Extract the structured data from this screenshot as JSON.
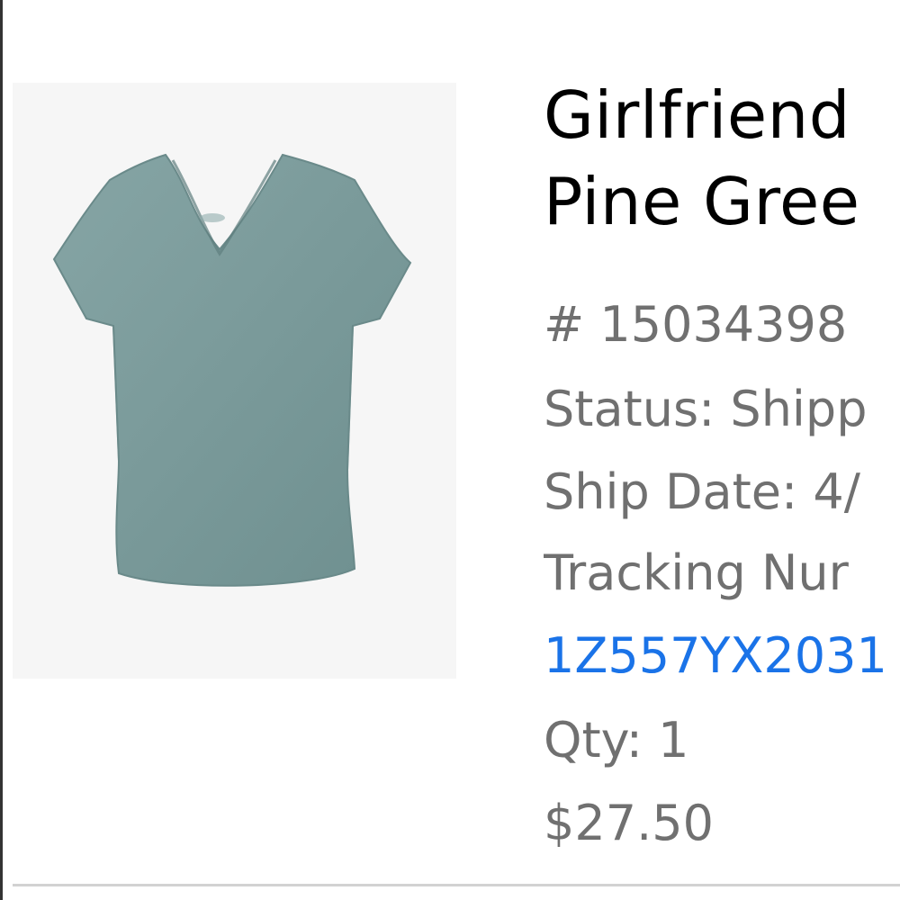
{
  "product": {
    "title_line1": "Girlfriend",
    "title_line2": "Pine Gree",
    "number": "# 15034398",
    "status": "Status: Shipp",
    "ship_date": "Ship Date: 4/",
    "tracking_label": "Tracking Nur",
    "tracking_number": "1Z557YX2031",
    "qty": "Qty: 1",
    "price": "$27.50",
    "image_icon": "tshirt-icon",
    "shirt_color": "#7a9a9a"
  },
  "colors": {
    "tracking_link": "#1a73e8",
    "info_text": "#707070",
    "title_text": "#000000"
  }
}
